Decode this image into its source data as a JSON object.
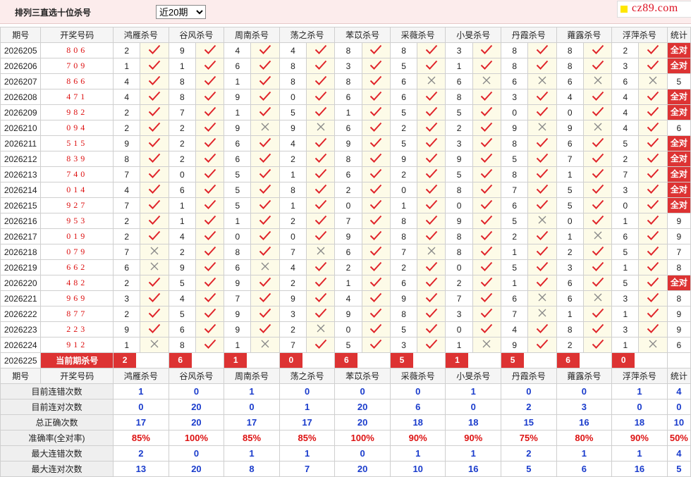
{
  "header": {
    "title": "排列三直选十位杀号",
    "period_select": "近20期",
    "logo": "cz89.com"
  },
  "columns": {
    "issue": "期号",
    "win": "开奖号码",
    "experts": [
      "鸿雁杀号",
      "谷风杀号",
      "周南杀号",
      "荡之杀号",
      "苯苡杀号",
      "采薇杀号",
      "小旻杀号",
      "丹霞杀号",
      "蕹露杀号",
      "浮萍杀号"
    ],
    "stat": "统计"
  },
  "rows": [
    {
      "issue": "2026205",
      "win": "806",
      "nums": [
        "2",
        "9",
        "4",
        "4",
        "8",
        "8",
        "3",
        "8",
        "8",
        "2"
      ],
      "ok": [
        1,
        1,
        1,
        1,
        1,
        1,
        1,
        1,
        1,
        1
      ],
      "stat": "全对"
    },
    {
      "issue": "2026206",
      "win": "709",
      "nums": [
        "1",
        "1",
        "6",
        "8",
        "3",
        "5",
        "1",
        "8",
        "8",
        "3"
      ],
      "ok": [
        1,
        1,
        1,
        1,
        1,
        1,
        1,
        1,
        1,
        1
      ],
      "stat": "全对"
    },
    {
      "issue": "2026207",
      "win": "866",
      "nums": [
        "4",
        "8",
        "1",
        "8",
        "8",
        "6",
        "6",
        "6",
        "6",
        "6"
      ],
      "ok": [
        1,
        1,
        1,
        1,
        1,
        0,
        0,
        0,
        0,
        0
      ],
      "stat": "5"
    },
    {
      "issue": "2026208",
      "win": "471",
      "nums": [
        "4",
        "8",
        "9",
        "0",
        "6",
        "6",
        "8",
        "3",
        "4",
        "4"
      ],
      "ok": [
        1,
        1,
        1,
        1,
        1,
        1,
        1,
        1,
        1,
        1
      ],
      "stat": "全对"
    },
    {
      "issue": "2026209",
      "win": "982",
      "nums": [
        "2",
        "7",
        "1",
        "5",
        "1",
        "5",
        "5",
        "0",
        "0",
        "4"
      ],
      "ok": [
        1,
        1,
        1,
        1,
        1,
        1,
        1,
        1,
        1,
        1
      ],
      "stat": "全对"
    },
    {
      "issue": "2026210",
      "win": "094",
      "nums": [
        "2",
        "2",
        "9",
        "9",
        "6",
        "2",
        "2",
        "9",
        "9",
        "4"
      ],
      "ok": [
        1,
        1,
        0,
        0,
        1,
        1,
        1,
        0,
        0,
        1
      ],
      "stat": "6"
    },
    {
      "issue": "2026211",
      "win": "515",
      "nums": [
        "9",
        "2",
        "6",
        "4",
        "9",
        "5",
        "3",
        "8",
        "6",
        "5"
      ],
      "ok": [
        1,
        1,
        1,
        1,
        1,
        1,
        1,
        1,
        1,
        1
      ],
      "stat": "全对"
    },
    {
      "issue": "2026212",
      "win": "839",
      "nums": [
        "8",
        "2",
        "6",
        "2",
        "8",
        "9",
        "9",
        "5",
        "7",
        "2"
      ],
      "ok": [
        1,
        1,
        1,
        1,
        1,
        1,
        1,
        1,
        1,
        1
      ],
      "stat": "全对"
    },
    {
      "issue": "2026213",
      "win": "740",
      "nums": [
        "7",
        "0",
        "5",
        "1",
        "6",
        "2",
        "5",
        "8",
        "1",
        "7"
      ],
      "ok": [
        1,
        1,
        1,
        1,
        1,
        1,
        1,
        1,
        1,
        1
      ],
      "stat": "全对"
    },
    {
      "issue": "2026214",
      "win": "014",
      "nums": [
        "4",
        "6",
        "5",
        "8",
        "2",
        "0",
        "8",
        "7",
        "5",
        "3"
      ],
      "ok": [
        1,
        1,
        1,
        1,
        1,
        1,
        1,
        1,
        1,
        1
      ],
      "stat": "全对"
    },
    {
      "issue": "2026215",
      "win": "927",
      "nums": [
        "7",
        "1",
        "5",
        "1",
        "0",
        "1",
        "0",
        "6",
        "5",
        "0"
      ],
      "ok": [
        1,
        1,
        1,
        1,
        1,
        1,
        1,
        1,
        1,
        1
      ],
      "stat": "全对"
    },
    {
      "issue": "2026216",
      "win": "953",
      "nums": [
        "2",
        "1",
        "1",
        "2",
        "7",
        "8",
        "9",
        "5",
        "0",
        "1"
      ],
      "ok": [
        1,
        1,
        1,
        1,
        1,
        1,
        1,
        0,
        1,
        1
      ],
      "stat": "9"
    },
    {
      "issue": "2026217",
      "win": "019",
      "nums": [
        "2",
        "4",
        "0",
        "0",
        "9",
        "8",
        "8",
        "2",
        "1",
        "6"
      ],
      "ok": [
        1,
        1,
        1,
        1,
        1,
        1,
        1,
        1,
        0,
        1
      ],
      "stat": "9"
    },
    {
      "issue": "2026218",
      "win": "079",
      "nums": [
        "7",
        "2",
        "8",
        "7",
        "6",
        "7",
        "8",
        "1",
        "2",
        "5"
      ],
      "ok": [
        0,
        1,
        1,
        0,
        1,
        0,
        1,
        1,
        1,
        1
      ],
      "stat": "7"
    },
    {
      "issue": "2026219",
      "win": "662",
      "nums": [
        "6",
        "9",
        "6",
        "4",
        "2",
        "2",
        "0",
        "5",
        "3",
        "1"
      ],
      "ok": [
        0,
        1,
        0,
        1,
        1,
        1,
        1,
        1,
        1,
        1
      ],
      "stat": "8"
    },
    {
      "issue": "2026220",
      "win": "482",
      "nums": [
        "2",
        "5",
        "9",
        "2",
        "1",
        "6",
        "2",
        "1",
        "6",
        "5"
      ],
      "ok": [
        1,
        1,
        1,
        1,
        1,
        1,
        1,
        1,
        1,
        1
      ],
      "stat": "全对"
    },
    {
      "issue": "2026221",
      "win": "969",
      "nums": [
        "3",
        "4",
        "7",
        "9",
        "4",
        "9",
        "7",
        "6",
        "6",
        "3"
      ],
      "ok": [
        1,
        1,
        1,
        1,
        1,
        1,
        1,
        0,
        0,
        1
      ],
      "stat": "8"
    },
    {
      "issue": "2026222",
      "win": "877",
      "nums": [
        "2",
        "5",
        "9",
        "3",
        "9",
        "8",
        "3",
        "7",
        "1",
        "1"
      ],
      "ok": [
        1,
        1,
        1,
        1,
        1,
        1,
        1,
        0,
        1,
        1
      ],
      "stat": "9"
    },
    {
      "issue": "2026223",
      "win": "223",
      "nums": [
        "9",
        "6",
        "9",
        "2",
        "0",
        "5",
        "0",
        "4",
        "8",
        "3"
      ],
      "ok": [
        1,
        1,
        1,
        0,
        1,
        1,
        1,
        1,
        1,
        1
      ],
      "stat": "9"
    },
    {
      "issue": "2026224",
      "win": "912",
      "nums": [
        "1",
        "8",
        "1",
        "7",
        "5",
        "3",
        "1",
        "9",
        "2",
        "1"
      ],
      "ok": [
        0,
        1,
        0,
        1,
        1,
        1,
        0,
        1,
        1,
        0
      ],
      "stat": "6"
    }
  ],
  "current": {
    "issue": "2026225",
    "label": "当前期杀号",
    "kills": [
      "2",
      "6",
      "1",
      "0",
      "6",
      "5",
      "1",
      "5",
      "6",
      "0"
    ]
  },
  "stats_rows": [
    {
      "label": "目前连错次数",
      "values": [
        "1",
        "0",
        "1",
        "0",
        "0",
        "0",
        "1",
        "0",
        "0",
        "1"
      ],
      "total": "4",
      "red": false
    },
    {
      "label": "目前连对次数",
      "values": [
        "0",
        "20",
        "0",
        "1",
        "20",
        "6",
        "0",
        "2",
        "3",
        "0"
      ],
      "total": "0",
      "red": false
    },
    {
      "label": "总正确次数",
      "values": [
        "17",
        "20",
        "17",
        "17",
        "20",
        "18",
        "18",
        "15",
        "16",
        "18"
      ],
      "total": "10",
      "red": false
    },
    {
      "label": "准确率(全对率)",
      "values": [
        "85%",
        "100%",
        "85%",
        "85%",
        "100%",
        "90%",
        "90%",
        "75%",
        "80%",
        "90%"
      ],
      "total": "50%",
      "red": true
    },
    {
      "label": "最大连错次数",
      "values": [
        "2",
        "0",
        "1",
        "1",
        "0",
        "1",
        "1",
        "2",
        "1",
        "1"
      ],
      "total": "4",
      "red": false
    },
    {
      "label": "最大连对次数",
      "values": [
        "13",
        "20",
        "8",
        "7",
        "20",
        "10",
        "16",
        "5",
        "6",
        "16"
      ],
      "total": "5",
      "red": false
    }
  ],
  "colors": {
    "accent": "#d33333",
    "check": "#e0242a",
    "cross": "#888888",
    "stat_blue": "#1a3ccc"
  }
}
